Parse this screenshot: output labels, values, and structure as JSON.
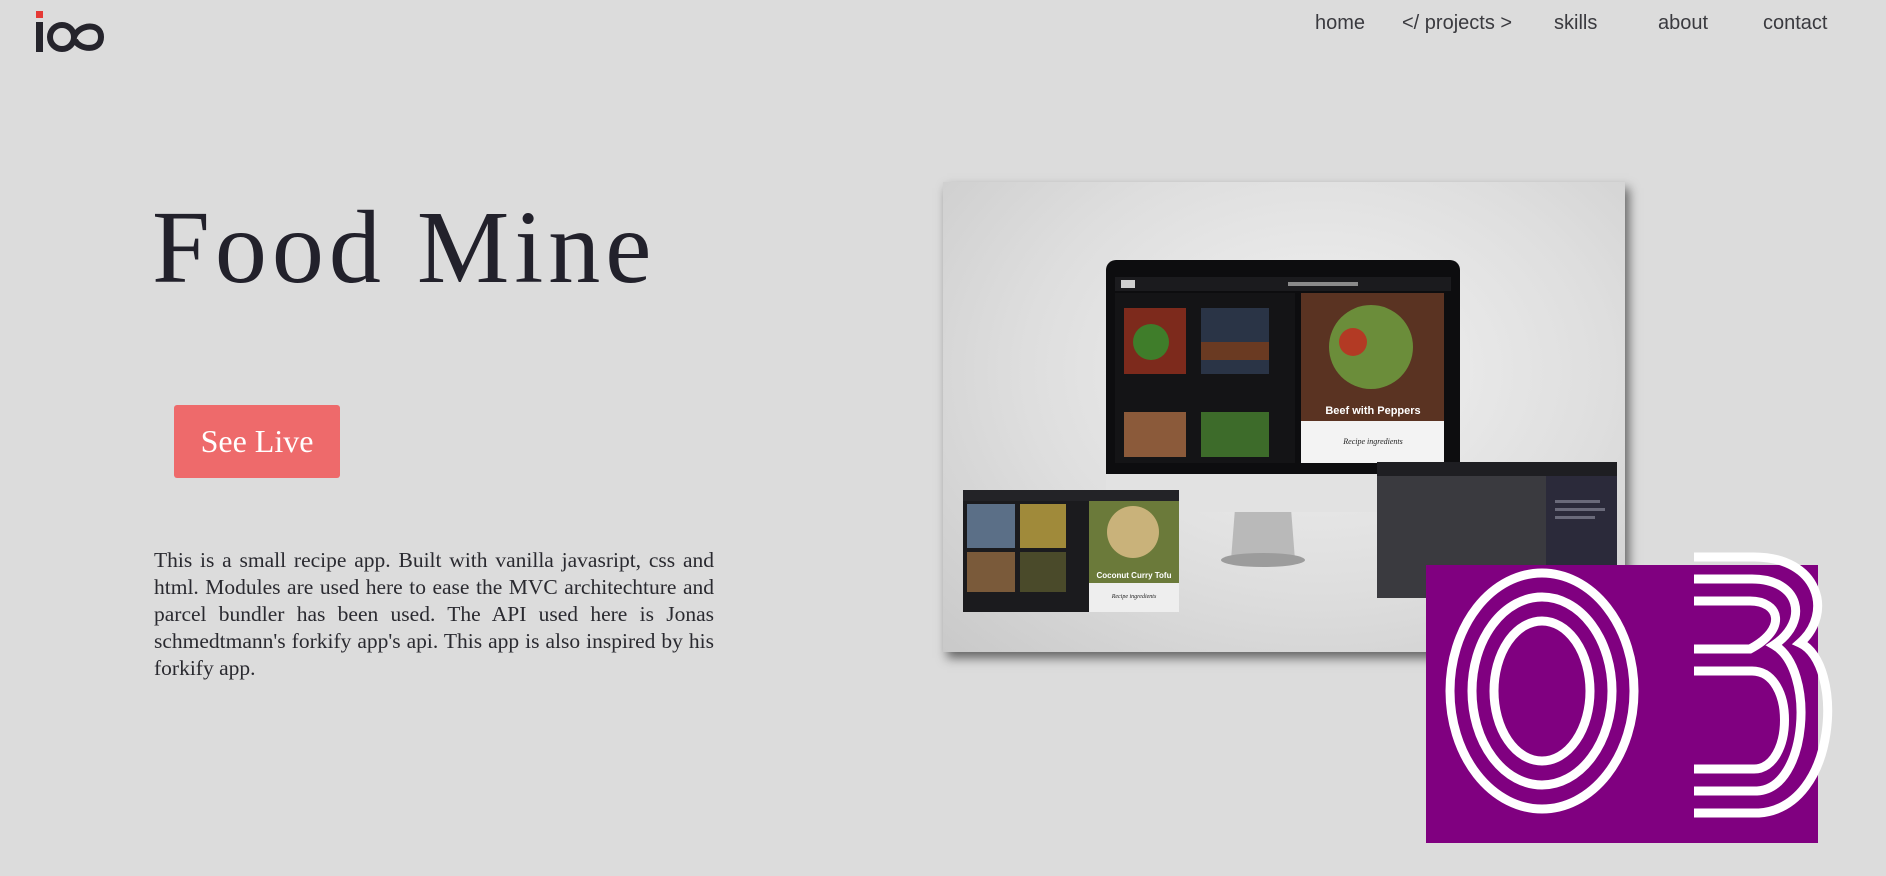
{
  "logo": {
    "icon": "io-logo-icon",
    "accent": "#e53935"
  },
  "nav": {
    "items": [
      {
        "label": "home"
      },
      {
        "label": "</ projects >"
      },
      {
        "label": "skills"
      },
      {
        "label": "about"
      },
      {
        "label": "contact"
      }
    ]
  },
  "project": {
    "title": "Food Mine",
    "cta_label": "See Live",
    "cta_color": "#ee6a6b",
    "description": "This is a small recipe app. Built with vanilla javasript, css and html. Modules are used here to ease the MVC architechture and parcel bundler has been used. The API used here is Jonas schmedtmann's forkify app's api. This app is also inspired by his forkify app.",
    "screenshot": {
      "main_recipe_title": "Beef with Peppers",
      "main_section_heading": "Recipe ingredients",
      "small_recipe_title": "Coconut Curry Tofu",
      "small_section_heading": "Recipe ingredients"
    },
    "number_badge": {
      "text": "03",
      "background": "#800080"
    }
  }
}
